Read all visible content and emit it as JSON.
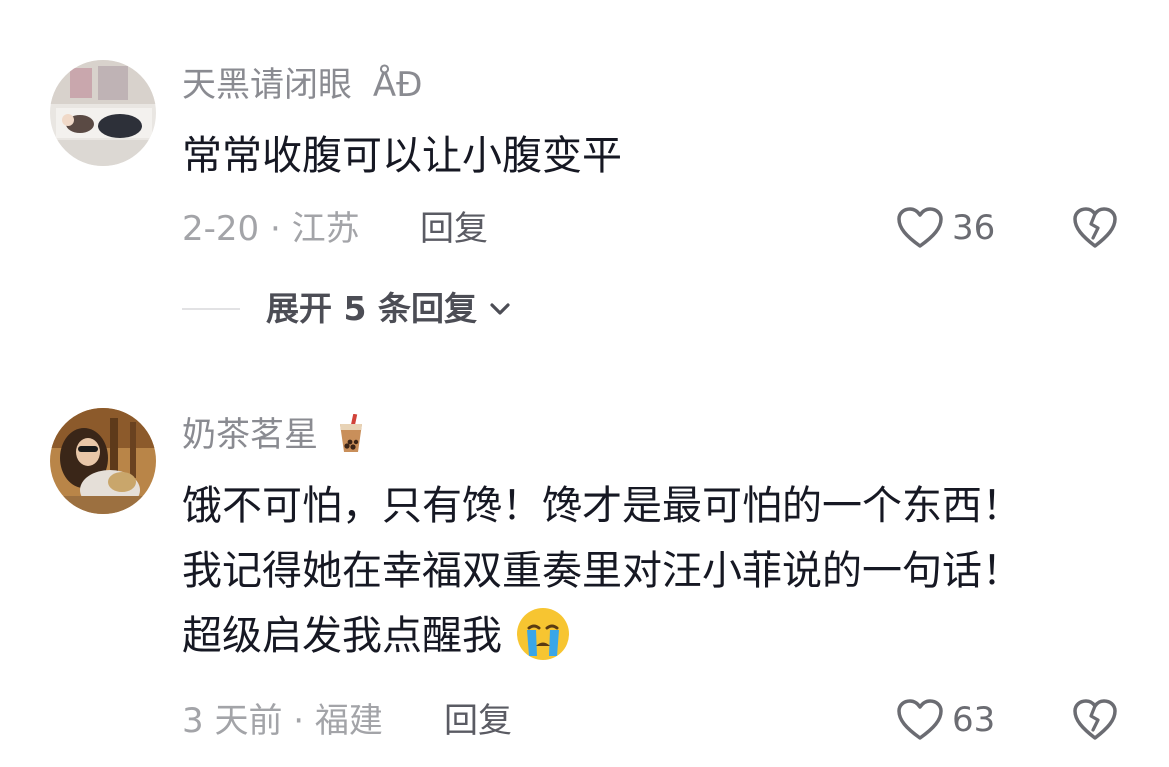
{
  "comments": [
    {
      "username": "天黑请闭眼",
      "username_suffix": "ÅĐ",
      "text_lines": [
        "常常收腹可以让小腹变平"
      ],
      "date_location": "2-20 · 江苏",
      "reply_label": "回复",
      "likes": "36",
      "expand_label": "展开 5 条回复"
    },
    {
      "username": "奶茶茗星",
      "username_icon": "bubble-tea-icon",
      "text_lines": [
        "饿不可怕，只有馋！馋才是最可怕的一个东西！",
        "我记得她在幸福双重奏里对汪小菲说的一句话！",
        "超级启发我点醒我"
      ],
      "text_emoji": "crying-face-icon",
      "date_location": "3 天前 · 福建",
      "reply_label": "回复",
      "likes": "63"
    }
  ],
  "colors": {
    "username": "#8a8b91",
    "body": "#161823",
    "meta": "#a3a4a8",
    "icon_stroke": "#6b6c72"
  }
}
